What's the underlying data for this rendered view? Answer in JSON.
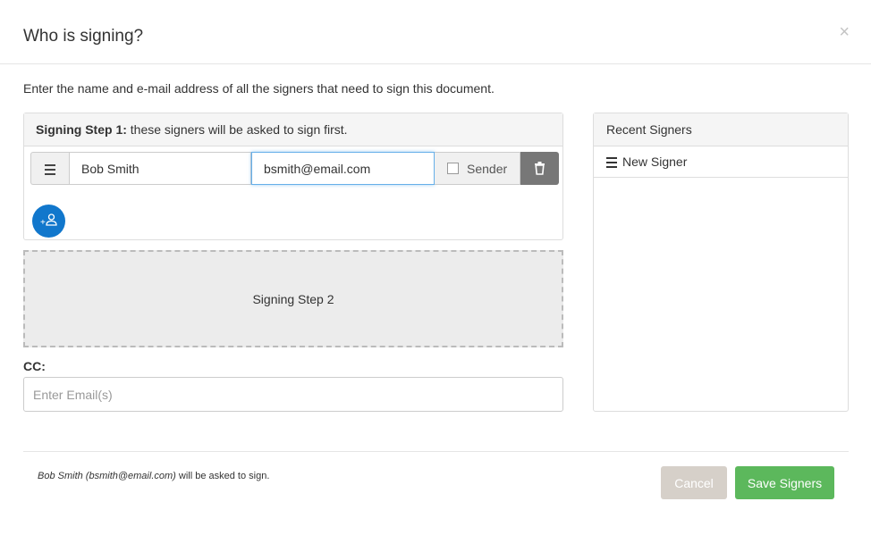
{
  "dialog": {
    "title": "Who is signing?",
    "close_glyph": "×"
  },
  "instructions": "Enter the name and e-mail address of all the signers that need to sign this document.",
  "step1": {
    "heading_bold": "Signing Step 1:",
    "heading_rest": " these signers will be asked to sign first.",
    "signers": [
      {
        "name": "Bob Smith",
        "email": "bsmith@email.com",
        "sender_label": "Sender",
        "sender_checked": false
      }
    ],
    "add_signer_icon": "add-person-icon"
  },
  "step2": {
    "label": "Signing Step 2"
  },
  "cc": {
    "label": "CC:",
    "placeholder": "Enter Email(s)",
    "value": ""
  },
  "recent": {
    "title": "Recent Signers",
    "items": [
      {
        "label": "New Signer",
        "icon": "list-icon"
      }
    ]
  },
  "footer": {
    "note_italic": "Bob Smith (bsmith@email.com)",
    "note_rest": " will be asked to sign.",
    "cancel_label": "Cancel",
    "save_label": "Save Signers"
  },
  "colors": {
    "accent_blue": "#1177cc",
    "save_green": "#5cb85c",
    "cancel_tan": "#d6d0c9",
    "delete_gray": "#777777"
  }
}
